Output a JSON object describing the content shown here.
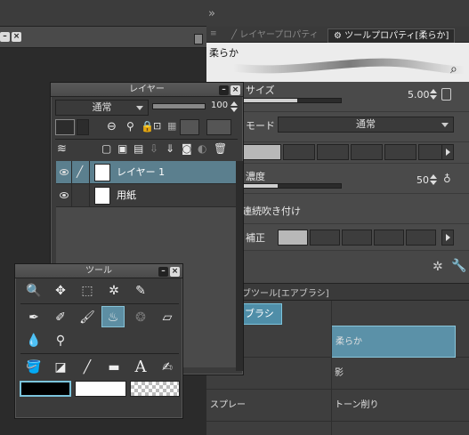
{
  "brush_properties_tabs": {
    "layer_property": "レイヤープロパティ",
    "tool_property": "ツールプロパティ[柔らか]"
  },
  "brush_name": "柔らか",
  "properties": {
    "brush_size_label": "サイズ",
    "brush_size_value": "5.00",
    "brush_size_fill": 0.55,
    "blend_mode_label": "モード",
    "blend_mode_value": "通常",
    "density_label": "濃度",
    "density_value": "50",
    "density_fill": 0.35,
    "continuous_spray_label": "連続吹き付け",
    "stabilization_label": "補正"
  },
  "layer_palette": {
    "title": "レイヤー",
    "blend_mode": "通常",
    "opacity": "100",
    "layers": [
      {
        "name": "レイヤー 1",
        "selected": true
      },
      {
        "name": "用紙",
        "selected": false
      }
    ]
  },
  "tool_palette": {
    "title": "ツール"
  },
  "subtool": {
    "header": "サブツール[エアブラシ]",
    "group_tab": "ブラシ",
    "rows": [
      {
        "left": "",
        "right": "柔らか",
        "selected": true
      },
      {
        "left": "",
        "right": "影",
        "selected": false
      },
      {
        "left": "スプレー",
        "right": "トーン削り",
        "selected": false
      }
    ]
  },
  "colors": {
    "accent": "#5d8ea3",
    "selection": "#5b7f8e"
  }
}
